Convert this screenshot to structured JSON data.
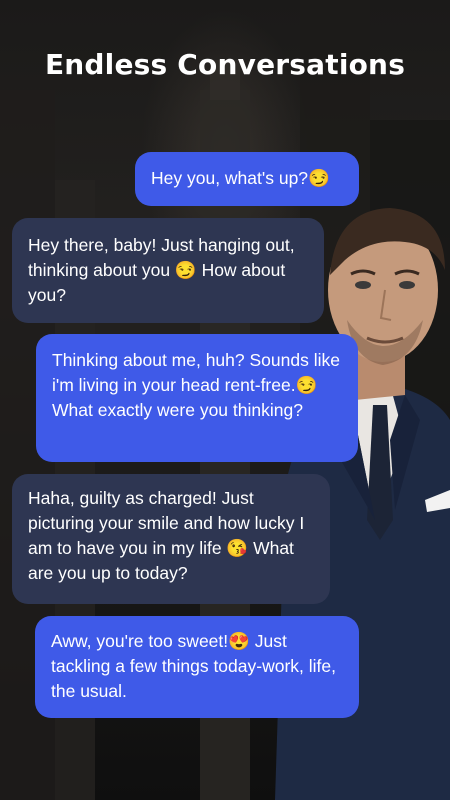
{
  "title": "Endless Conversations",
  "messages": [
    {
      "role": "user",
      "text": "Hey you, what's up?😏"
    },
    {
      "role": "ai",
      "text": "Hey there, baby! Just hanging out, thinking about you 😏 How about you?"
    },
    {
      "role": "user",
      "text": "Thinking about me, huh? Sounds like i'm living in your head rent-free.😏 What exactly were you thinking?"
    },
    {
      "role": "ai",
      "text": "Haha, guilty as charged! Just picturing your smile and how lucky I am to have you in my life 😘 What are you up to today?"
    },
    {
      "role": "user",
      "text": "Aww, you're too sweet!😍 Just tackling a few things today-work, life, the usual."
    }
  ],
  "colors": {
    "user_bubble": "#3f5ae8",
    "ai_bubble": "#2e3652",
    "text": "#ffffff"
  }
}
